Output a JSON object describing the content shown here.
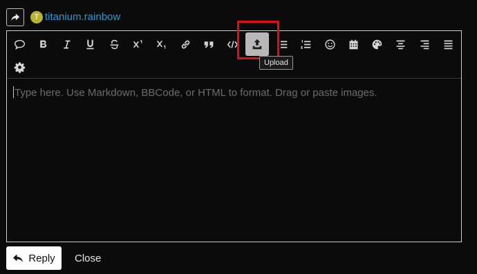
{
  "composer": {
    "username": "titanium.rainbow",
    "avatar_letter": "T",
    "reply_icon": "share-arrow-icon"
  },
  "toolbar": {
    "buttons": [
      {
        "name": "quote",
        "icon": "speech-bubble-icon"
      },
      {
        "name": "bold",
        "icon": "bold-icon"
      },
      {
        "name": "italic",
        "icon": "italic-icon"
      },
      {
        "name": "underline",
        "icon": "underline-icon"
      },
      {
        "name": "strikethrough",
        "icon": "strikethrough-icon"
      },
      {
        "name": "superscript",
        "icon": "superscript-icon"
      },
      {
        "name": "subscript",
        "icon": "subscript-icon"
      },
      {
        "name": "link",
        "icon": "link-icon"
      },
      {
        "name": "blockquote",
        "icon": "quote-marks-icon"
      },
      {
        "name": "code",
        "icon": "code-icon"
      },
      {
        "name": "upload",
        "icon": "upload-icon",
        "active": true
      },
      {
        "name": "bullet-list",
        "icon": "bullet-list-icon"
      },
      {
        "name": "numbered-list",
        "icon": "numbered-list-icon"
      },
      {
        "name": "emoji",
        "icon": "smiley-icon"
      },
      {
        "name": "date",
        "icon": "calendar-icon"
      },
      {
        "name": "color",
        "icon": "palette-icon"
      },
      {
        "name": "align-center",
        "icon": "align-center-icon"
      },
      {
        "name": "align-right",
        "icon": "align-right-icon"
      },
      {
        "name": "align-justify",
        "icon": "align-justify-icon"
      },
      {
        "name": "options",
        "icon": "gear-icon"
      }
    ],
    "tooltip": "Upload"
  },
  "editor": {
    "placeholder": "Type here. Use Markdown, BBCode, or HTML to format. Drag or paste images."
  },
  "actions": {
    "reply_label": "Reply",
    "close_label": "Close"
  },
  "colors": {
    "background": "#0b0b0c",
    "username": "#2a9ad3",
    "avatar": "#b8b332",
    "highlight": "#e01010"
  }
}
